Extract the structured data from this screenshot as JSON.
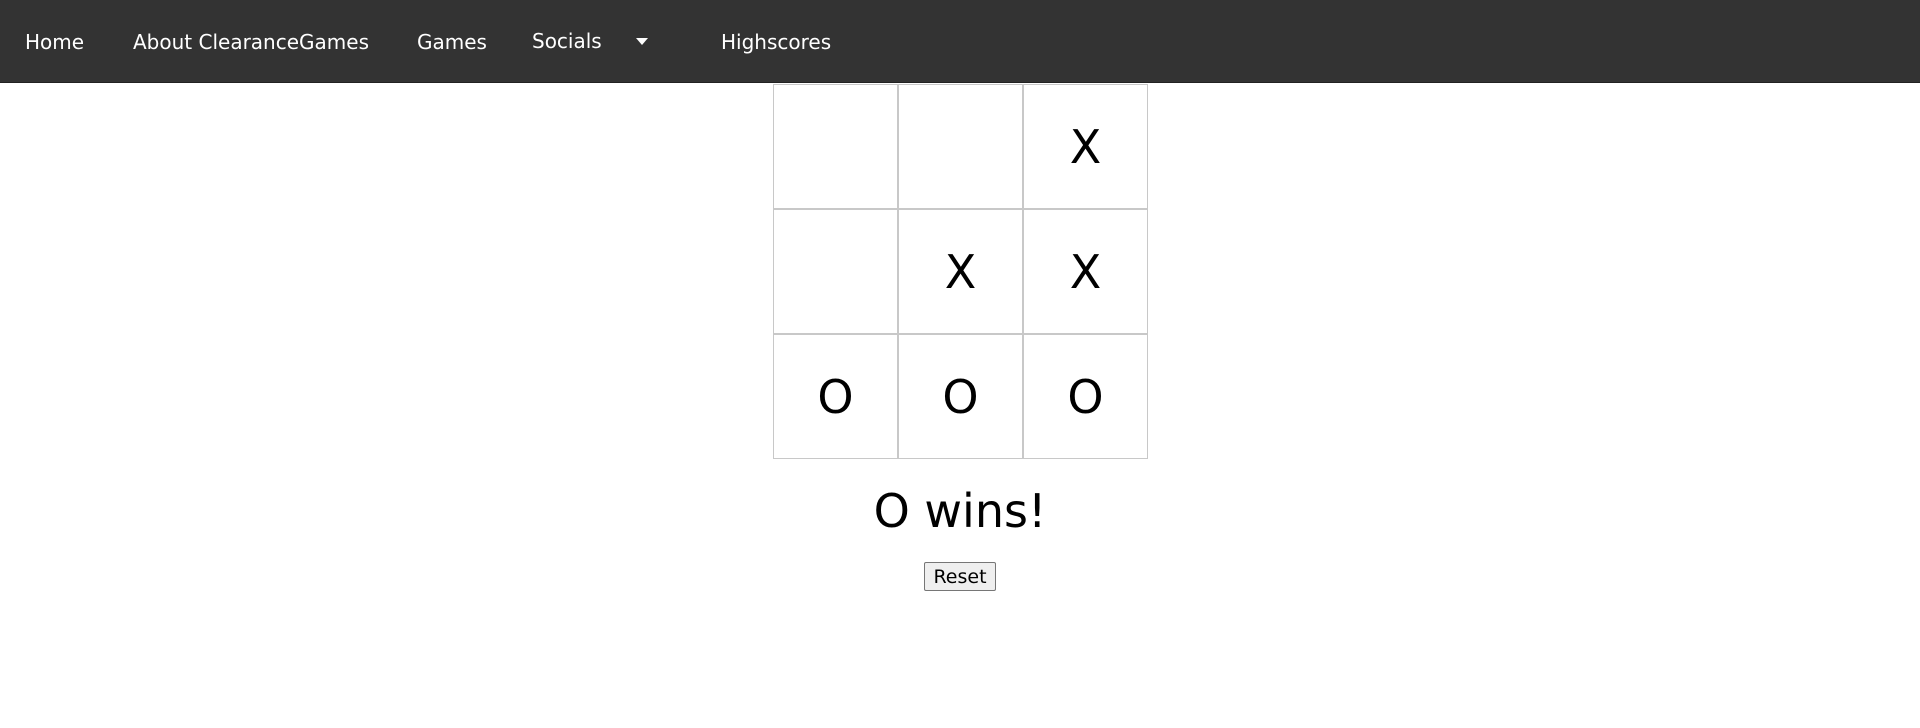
{
  "nav": {
    "home": "Home",
    "about": "About ClearanceGames",
    "games": "Games",
    "socials": "Socials",
    "highscores": "Highscores"
  },
  "board": {
    "cells": [
      "",
      "",
      "X",
      "",
      "X",
      "X",
      "O",
      "O",
      "O"
    ]
  },
  "status": "O wins!",
  "reset_label": "Reset",
  "colors": {
    "navbar": "#333333",
    "nav_text": "#ffffff",
    "grid_line": "#c8c8c8"
  }
}
